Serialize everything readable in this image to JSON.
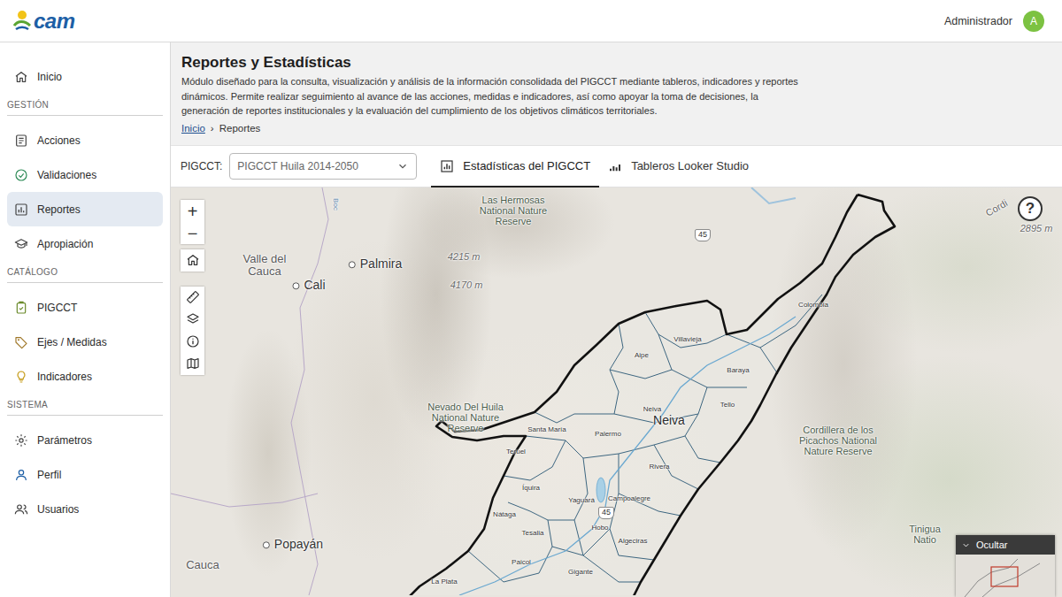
{
  "header": {
    "logo": "cam",
    "user": {
      "name": "Administrador",
      "avatar": "A"
    }
  },
  "sidebar": {
    "home": {
      "label": "Inicio",
      "selected": false
    },
    "sections": [
      {
        "title": "GESTIÓN",
        "items": [
          {
            "label": "Acciones",
            "selected": false
          },
          {
            "label": "Validaciones",
            "selected": false
          },
          {
            "label": "Reportes",
            "selected": true
          },
          {
            "label": "Apropiación",
            "selected": false
          }
        ]
      },
      {
        "title": "CATÁLOGO",
        "items": [
          {
            "label": "PIGCCT",
            "selected": false
          },
          {
            "label": "Ejes / Medidas",
            "selected": false
          },
          {
            "label": "Indicadores",
            "selected": false
          }
        ]
      },
      {
        "title": "SISTEMA",
        "items": [
          {
            "label": "Parámetros",
            "selected": false
          },
          {
            "label": "Perfil",
            "selected": false
          },
          {
            "label": "Usuarios",
            "selected": false
          }
        ]
      }
    ]
  },
  "page": {
    "title": "Reportes y Estadísticas",
    "description": "Módulo diseñado para la consulta, visualización y análisis de la información consolidada del PIGCCT mediante tableros, indicadores y reportes dinámicos. Permite realizar seguimiento al avance de las acciones, medidas e indicadores, así como apoyar la toma de decisiones, la generación de reportes institucionales y la evaluación del cumplimiento de los objetivos climáticos territoriales.",
    "breadcrumb": {
      "separator": "›",
      "items": [
        {
          "label": "Inicio",
          "kind": "link"
        },
        {
          "label": "Reportes",
          "kind": "current"
        }
      ]
    }
  },
  "toolbar": {
    "label": "PIGCCT:",
    "select": {
      "value": "PIGCCT Huila 2014-2050"
    },
    "tabs": [
      {
        "label": "Estadísticas del PIGCCT",
        "selected": true
      },
      {
        "label": "Tableros Looker Studio",
        "selected": false
      }
    ]
  },
  "map": {
    "controls": {
      "zoom_in": "+",
      "zoom_out": "−"
    },
    "help": "?",
    "overview": {
      "toggle": "Ocultar",
      "expanded": true
    },
    "labels": [
      {
        "text": "Las Hermosas National Nature Reserve",
        "kind": "reserve"
      },
      {
        "text": "Valle del Cauca",
        "kind": "region"
      },
      {
        "text": "Palmira",
        "kind": "city"
      },
      {
        "text": "Cali",
        "kind": "city"
      },
      {
        "text": "4215 m",
        "kind": "elevation"
      },
      {
        "text": "4170 m",
        "kind": "elevation"
      },
      {
        "text": "45",
        "kind": "road"
      },
      {
        "text": "Colombia",
        "kind": "municipality"
      },
      {
        "text": "Villavieja",
        "kind": "municipality"
      },
      {
        "text": "Aipe",
        "kind": "municipality"
      },
      {
        "text": "Baraya",
        "kind": "municipality"
      },
      {
        "text": "Tello",
        "kind": "municipality"
      },
      {
        "text": "Neiva",
        "kind": "municipality"
      },
      {
        "text": "Neiva",
        "kind": "capital"
      },
      {
        "text": "Nevado Del Huila National Nature Reserve",
        "kind": "reserve"
      },
      {
        "text": "Santa María",
        "kind": "municipality"
      },
      {
        "text": "Palermo",
        "kind": "municipality"
      },
      {
        "text": "Teruel",
        "kind": "municipality"
      },
      {
        "text": "Rivera",
        "kind": "municipality"
      },
      {
        "text": "Íquira",
        "kind": "municipality"
      },
      {
        "text": "Yaguará",
        "kind": "municipality"
      },
      {
        "text": "Campoalegre",
        "kind": "municipality"
      },
      {
        "text": "45",
        "kind": "road"
      },
      {
        "text": "Nátaga",
        "kind": "municipality"
      },
      {
        "text": "Tesalia",
        "kind": "municipality"
      },
      {
        "text": "Hobo",
        "kind": "municipality"
      },
      {
        "text": "Algeciras",
        "kind": "municipality"
      },
      {
        "text": "Paicol",
        "kind": "municipality"
      },
      {
        "text": "Gigante",
        "kind": "municipality"
      },
      {
        "text": "La Plata",
        "kind": "municipality"
      },
      {
        "text": "Popayán",
        "kind": "city"
      },
      {
        "text": "Cauca",
        "kind": "region"
      },
      {
        "text": "Cordillera de los Picachos National Nature Reserve",
        "kind": "reserve"
      },
      {
        "text": "Tinigua Natio",
        "kind": "reserve"
      },
      {
        "text": "Cordi",
        "kind": "range"
      },
      {
        "text": "2895 m",
        "kind": "elevation"
      },
      {
        "text": "Boc",
        "kind": "river"
      }
    ]
  }
}
